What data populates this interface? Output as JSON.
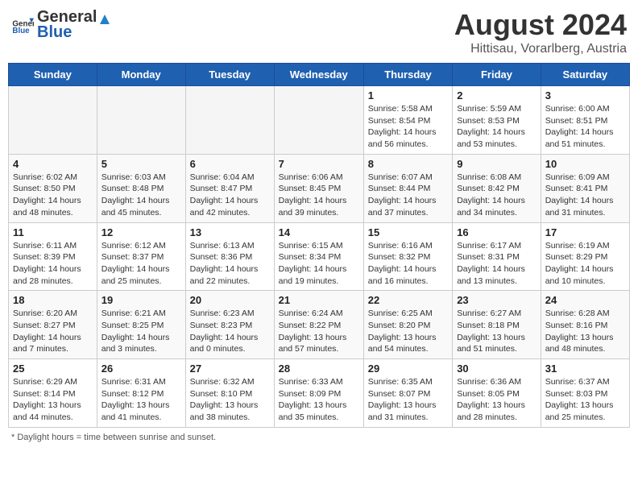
{
  "header": {
    "logo_general": "General",
    "logo_blue": "Blue",
    "title": "August 2024",
    "location": "Hittisau, Vorarlberg, Austria"
  },
  "weekdays": [
    "Sunday",
    "Monday",
    "Tuesday",
    "Wednesday",
    "Thursday",
    "Friday",
    "Saturday"
  ],
  "footer": {
    "note": "Daylight hours"
  },
  "weeks": [
    [
      {
        "day": "",
        "info": ""
      },
      {
        "day": "",
        "info": ""
      },
      {
        "day": "",
        "info": ""
      },
      {
        "day": "",
        "info": ""
      },
      {
        "day": "1",
        "info": "Sunrise: 5:58 AM\nSunset: 8:54 PM\nDaylight: 14 hours\nand 56 minutes."
      },
      {
        "day": "2",
        "info": "Sunrise: 5:59 AM\nSunset: 8:53 PM\nDaylight: 14 hours\nand 53 minutes."
      },
      {
        "day": "3",
        "info": "Sunrise: 6:00 AM\nSunset: 8:51 PM\nDaylight: 14 hours\nand 51 minutes."
      }
    ],
    [
      {
        "day": "4",
        "info": "Sunrise: 6:02 AM\nSunset: 8:50 PM\nDaylight: 14 hours\nand 48 minutes."
      },
      {
        "day": "5",
        "info": "Sunrise: 6:03 AM\nSunset: 8:48 PM\nDaylight: 14 hours\nand 45 minutes."
      },
      {
        "day": "6",
        "info": "Sunrise: 6:04 AM\nSunset: 8:47 PM\nDaylight: 14 hours\nand 42 minutes."
      },
      {
        "day": "7",
        "info": "Sunrise: 6:06 AM\nSunset: 8:45 PM\nDaylight: 14 hours\nand 39 minutes."
      },
      {
        "day": "8",
        "info": "Sunrise: 6:07 AM\nSunset: 8:44 PM\nDaylight: 14 hours\nand 37 minutes."
      },
      {
        "day": "9",
        "info": "Sunrise: 6:08 AM\nSunset: 8:42 PM\nDaylight: 14 hours\nand 34 minutes."
      },
      {
        "day": "10",
        "info": "Sunrise: 6:09 AM\nSunset: 8:41 PM\nDaylight: 14 hours\nand 31 minutes."
      }
    ],
    [
      {
        "day": "11",
        "info": "Sunrise: 6:11 AM\nSunset: 8:39 PM\nDaylight: 14 hours\nand 28 minutes."
      },
      {
        "day": "12",
        "info": "Sunrise: 6:12 AM\nSunset: 8:37 PM\nDaylight: 14 hours\nand 25 minutes."
      },
      {
        "day": "13",
        "info": "Sunrise: 6:13 AM\nSunset: 8:36 PM\nDaylight: 14 hours\nand 22 minutes."
      },
      {
        "day": "14",
        "info": "Sunrise: 6:15 AM\nSunset: 8:34 PM\nDaylight: 14 hours\nand 19 minutes."
      },
      {
        "day": "15",
        "info": "Sunrise: 6:16 AM\nSunset: 8:32 PM\nDaylight: 14 hours\nand 16 minutes."
      },
      {
        "day": "16",
        "info": "Sunrise: 6:17 AM\nSunset: 8:31 PM\nDaylight: 14 hours\nand 13 minutes."
      },
      {
        "day": "17",
        "info": "Sunrise: 6:19 AM\nSunset: 8:29 PM\nDaylight: 14 hours\nand 10 minutes."
      }
    ],
    [
      {
        "day": "18",
        "info": "Sunrise: 6:20 AM\nSunset: 8:27 PM\nDaylight: 14 hours\nand 7 minutes."
      },
      {
        "day": "19",
        "info": "Sunrise: 6:21 AM\nSunset: 8:25 PM\nDaylight: 14 hours\nand 3 minutes."
      },
      {
        "day": "20",
        "info": "Sunrise: 6:23 AM\nSunset: 8:23 PM\nDaylight: 14 hours\nand 0 minutes."
      },
      {
        "day": "21",
        "info": "Sunrise: 6:24 AM\nSunset: 8:22 PM\nDaylight: 13 hours\nand 57 minutes."
      },
      {
        "day": "22",
        "info": "Sunrise: 6:25 AM\nSunset: 8:20 PM\nDaylight: 13 hours\nand 54 minutes."
      },
      {
        "day": "23",
        "info": "Sunrise: 6:27 AM\nSunset: 8:18 PM\nDaylight: 13 hours\nand 51 minutes."
      },
      {
        "day": "24",
        "info": "Sunrise: 6:28 AM\nSunset: 8:16 PM\nDaylight: 13 hours\nand 48 minutes."
      }
    ],
    [
      {
        "day": "25",
        "info": "Sunrise: 6:29 AM\nSunset: 8:14 PM\nDaylight: 13 hours\nand 44 minutes."
      },
      {
        "day": "26",
        "info": "Sunrise: 6:31 AM\nSunset: 8:12 PM\nDaylight: 13 hours\nand 41 minutes."
      },
      {
        "day": "27",
        "info": "Sunrise: 6:32 AM\nSunset: 8:10 PM\nDaylight: 13 hours\nand 38 minutes."
      },
      {
        "day": "28",
        "info": "Sunrise: 6:33 AM\nSunset: 8:09 PM\nDaylight: 13 hours\nand 35 minutes."
      },
      {
        "day": "29",
        "info": "Sunrise: 6:35 AM\nSunset: 8:07 PM\nDaylight: 13 hours\nand 31 minutes."
      },
      {
        "day": "30",
        "info": "Sunrise: 6:36 AM\nSunset: 8:05 PM\nDaylight: 13 hours\nand 28 minutes."
      },
      {
        "day": "31",
        "info": "Sunrise: 6:37 AM\nSunset: 8:03 PM\nDaylight: 13 hours\nand 25 minutes."
      }
    ]
  ]
}
